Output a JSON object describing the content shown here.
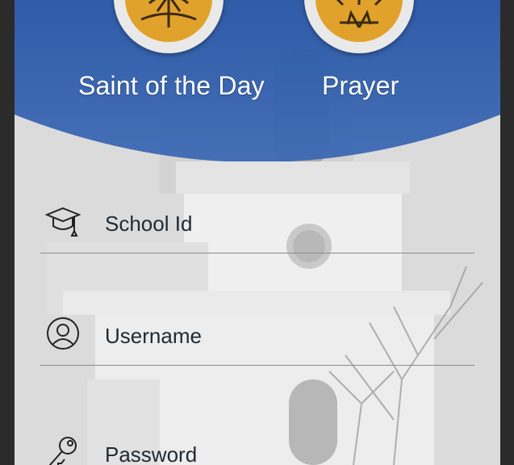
{
  "header": {
    "saint_label": "Saint of the Day",
    "prayer_label": "Prayer"
  },
  "form": {
    "school_id_placeholder": "School Id",
    "username_placeholder": "Username",
    "password_placeholder": "Password"
  },
  "colors": {
    "header_blue": "#2f5cab",
    "icon_gold": "#e1a22c",
    "text_dark": "#1f2a33"
  },
  "icons": {
    "saint": "saint-icon",
    "prayer": "praying-hands-icon",
    "school": "graduation-cap-icon",
    "user": "user-icon",
    "key": "key-icon"
  }
}
